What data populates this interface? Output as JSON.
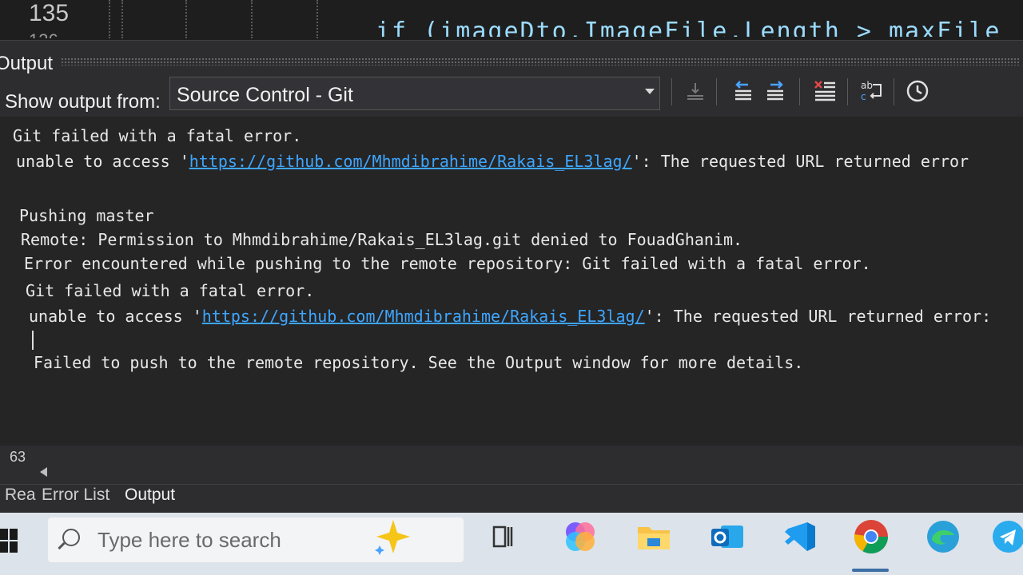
{
  "editor": {
    "line_number": "135",
    "line_number_next": "136",
    "code_fragment": "if (imageDto.ImageFile.Length > maxFile"
  },
  "panel": {
    "title": "Output",
    "show_output_label": "Show output from:",
    "source_selected": "Source Control - Git"
  },
  "output": {
    "lines": [
      {
        "text": "Git failed with a fatal error."
      },
      {
        "prefix": "unable to access '",
        "url": "https://github.com/Mhmdibrahime/Rakais_EL3lag/",
        "suffix": "': The requested URL returned error"
      },
      {
        "text": "Pushing master"
      },
      {
        "text": "Remote: Permission to Mhmdibrahime/Rakais_EL3lag.git denied to FouadGhanim."
      },
      {
        "text": "Error encountered while pushing to the remote repository: Git failed with a fatal error."
      },
      {
        "text": "Git failed with a fatal error."
      },
      {
        "prefix": "unable to access '",
        "url": "https://github.com/Mhmdibrahime/Rakais_EL3lag/",
        "suffix": "': The requested URL returned error:"
      },
      {
        "text": "Failed to push to the remote repository. See the Output window for more details."
      }
    ]
  },
  "status": {
    "line_indicator": "63"
  },
  "tabs": [
    {
      "label": "Rea"
    },
    {
      "label": "Error List"
    },
    {
      "label": "Output"
    }
  ],
  "taskbar": {
    "search_placeholder": "Type here to search"
  },
  "colors": {
    "accent_link": "#3ea6ff",
    "panel_bg": "#252526",
    "taskbar_bg": "#dde3ea"
  }
}
